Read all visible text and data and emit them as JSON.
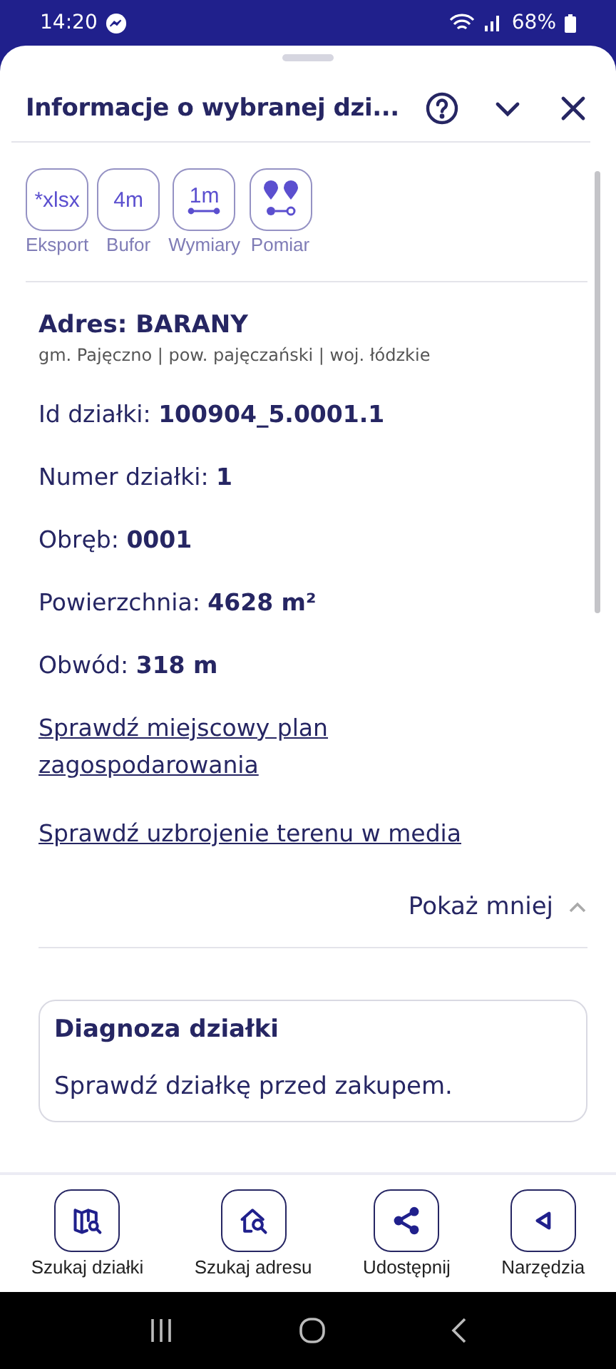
{
  "status_bar": {
    "time": "14:20",
    "battery": "68%"
  },
  "header": {
    "title": "Informacje o wybranej dzi..."
  },
  "tools": [
    {
      "kind": "text",
      "value": "*xlsx",
      "label": "Eksport"
    },
    {
      "kind": "text",
      "value": "4m",
      "label": "Bufor"
    },
    {
      "kind": "dimension",
      "value": "1m",
      "label": "Wymiary"
    },
    {
      "kind": "icon",
      "label": "Pomiar"
    }
  ],
  "address": {
    "title": "Adres: BARANY",
    "subtitle": "gm. Pajęczno | pow. pajęczański | woj. łódzkie"
  },
  "fields": [
    {
      "label": "Id działki:",
      "value": "100904_5.0001.1"
    },
    {
      "label": "Numer działki:",
      "value": "1"
    },
    {
      "label": "Obręb:",
      "value": "0001"
    },
    {
      "label": "Powierzchnia:",
      "value": "4628 m²"
    },
    {
      "label": "Obwód:",
      "value": "318 m"
    }
  ],
  "links": [
    "Sprawdź miejscowy plan zagospodarowania",
    "Sprawdź uzbrojenie terenu w media"
  ],
  "toggle": {
    "label": "Pokaż mniej",
    "expanded": true
  },
  "diagnosis": {
    "title": "Diagnoza działki",
    "text": "Sprawdź działkę przed zakupem."
  },
  "bottom_nav": [
    {
      "kind": "map",
      "label": "Szukaj działki"
    },
    {
      "kind": "house",
      "label": "Szukaj adresu"
    },
    {
      "kind": "share",
      "label": "Udostępnij"
    },
    {
      "kind": "tools",
      "label": "Narzędzia"
    }
  ]
}
